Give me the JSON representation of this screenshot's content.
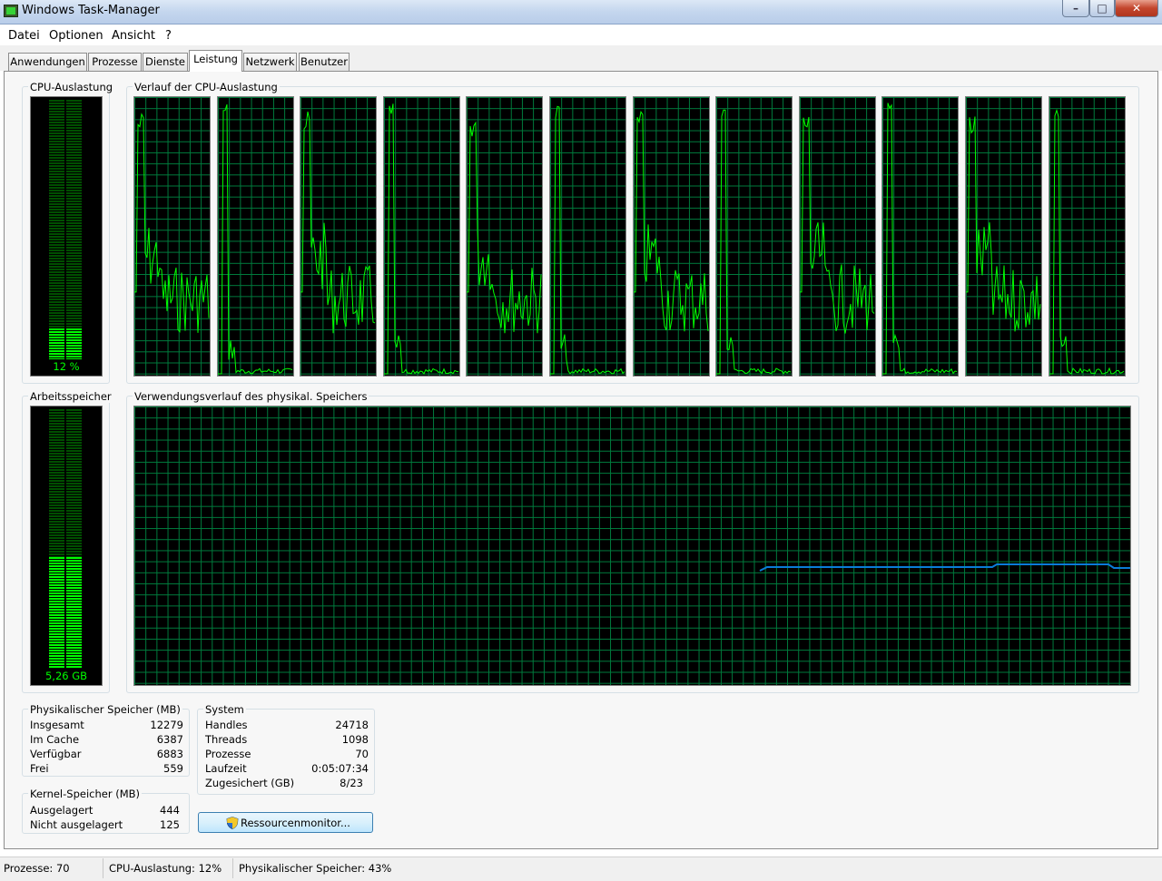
{
  "window": {
    "title": "Windows Task-Manager",
    "controls": {
      "minimize": "–",
      "maximize": "□",
      "close": "✕"
    }
  },
  "menu": [
    "Datei",
    "Optionen",
    "Ansicht",
    "?"
  ],
  "tabs": [
    {
      "label": "Anwendungen",
      "active": false
    },
    {
      "label": "Prozesse",
      "active": false
    },
    {
      "label": "Dienste",
      "active": false
    },
    {
      "label": "Leistung",
      "active": true
    },
    {
      "label": "Netzwerk",
      "active": false
    },
    {
      "label": "Benutzer",
      "active": false
    }
  ],
  "cpu": {
    "group_label": "CPU-Auslastung",
    "value_label": "12 %",
    "usage_fraction": 0.12,
    "history_label": "Verlauf der CPU-Auslastung",
    "core_count": 12
  },
  "memory": {
    "group_label": "Arbeitsspeicher",
    "value_label": "5,26 GB",
    "usage_fraction": 0.43,
    "history_label": "Verwendungsverlauf des physikal. Speichers"
  },
  "physical_memory": {
    "label": "Physikalischer Speicher (MB)",
    "rows": [
      {
        "name": "Insgesamt",
        "value": "12279"
      },
      {
        "name": "Im Cache",
        "value": "6387"
      },
      {
        "name": "Verfügbar",
        "value": "6883"
      },
      {
        "name": "Frei",
        "value": "559"
      }
    ]
  },
  "kernel_memory": {
    "label": "Kernel-Speicher (MB)",
    "rows": [
      {
        "name": "Ausgelagert",
        "value": "444"
      },
      {
        "name": "Nicht ausgelagert",
        "value": "125"
      }
    ]
  },
  "system": {
    "label": "System",
    "rows": [
      {
        "name": "Handles",
        "value": "24718"
      },
      {
        "name": "Threads",
        "value": "1098"
      },
      {
        "name": "Prozesse",
        "value": "70"
      },
      {
        "name": "Laufzeit",
        "value": "0:05:07:34"
      },
      {
        "name": "Zugesichert (GB)",
        "value": "8/23"
      }
    ]
  },
  "resource_monitor_button": "Ressourcenmonitor...",
  "statusbar": {
    "processes": "Prozesse: 70",
    "cpu": "CPU-Auslastung: 12%",
    "memory": "Physikalischer Speicher: 43%"
  },
  "colors": {
    "graph_line": "#00ff00",
    "memory_line": "#0a7cd8",
    "grid": "#007c3d"
  }
}
